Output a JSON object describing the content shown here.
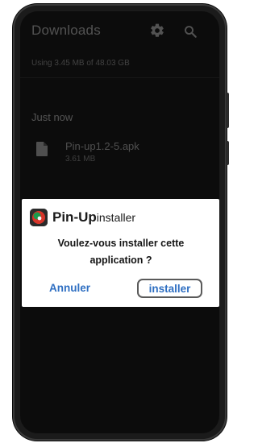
{
  "header": {
    "title": "Downloads",
    "icons": [
      "gear-icon",
      "search-icon"
    ]
  },
  "storage": {
    "text": "Using 3.45 MB of 48.03 GB"
  },
  "section": {
    "label": "Just now"
  },
  "file": {
    "name": "Pin-up1.2-5.apk",
    "size": "3.61 MB",
    "icon": "file-icon"
  },
  "dialog": {
    "brand": "Pin-Up",
    "brand_suffix": "installer",
    "message": "Voulez-vous installer cette application ?",
    "cancel_label": "Annuler",
    "install_label": "installer",
    "accent_color": "#2f6fc2",
    "icon": "app-icon"
  }
}
